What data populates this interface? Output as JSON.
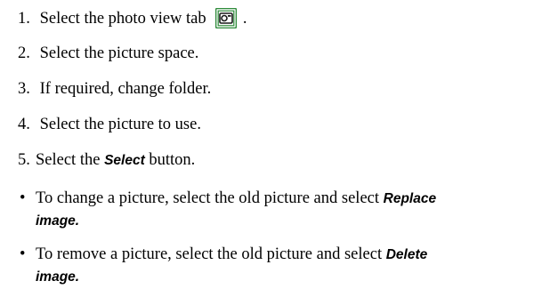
{
  "steps": [
    {
      "number": "1.",
      "text": "Select the photo view tab",
      "suffix": "."
    },
    {
      "number": "2.",
      "text": "Select the picture space."
    },
    {
      "number": "3.",
      "text": "If required, change folder."
    },
    {
      "number": "4.",
      "text": "Select the picture to use."
    },
    {
      "number": "5.",
      "text_before": "Select the ",
      "button_label": "Select",
      "text_after": " button."
    }
  ],
  "icons": {
    "photo_view_tab": "photo-view-tab-icon",
    "icon_colors": {
      "border": "#2e8b3a",
      "fill": "#ffffff",
      "glyph": "#1a1a1a"
    }
  },
  "bullets": [
    {
      "symbol": "•",
      "text": "To change a picture, select the old picture and select",
      "term_part1": "Replace",
      "term_part2": "image."
    },
    {
      "symbol": "•",
      "text": "To remove a picture, select the old picture and select",
      "term_part1": "Delete",
      "term_part2": "image."
    }
  ]
}
